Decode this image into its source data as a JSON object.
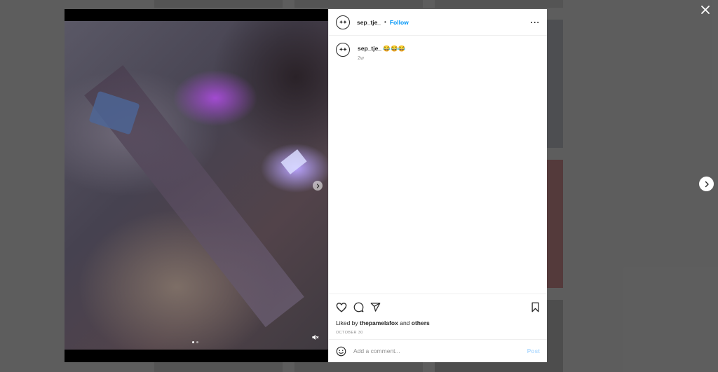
{
  "colors": {
    "accent": "#0095f6",
    "post_disabled": "#b3dbff"
  },
  "icons": {
    "close": "close-icon",
    "next": "chevron-right-icon",
    "more": "more-options-icon",
    "like": "heart-icon",
    "comment": "comment-icon",
    "share": "paper-plane-icon",
    "save": "bookmark-icon",
    "emoji": "emoji-icon",
    "mute": "speaker-muted-icon"
  },
  "post": {
    "header": {
      "username": "sep_tje_",
      "separator": "•",
      "follow_label": "Follow",
      "more_label": "···"
    },
    "caption": {
      "username": "sep_tje_",
      "text": "😂😂😂",
      "age": "2w"
    },
    "likes": {
      "prefix": "Liked by",
      "user": "thepamelafox",
      "conjunction": "and",
      "others": "others"
    },
    "date": "OCTOBER 30",
    "carousel": {
      "count": 2,
      "current": 1
    }
  },
  "comment_box": {
    "placeholder": "Add a comment...",
    "post_label": "Post"
  }
}
